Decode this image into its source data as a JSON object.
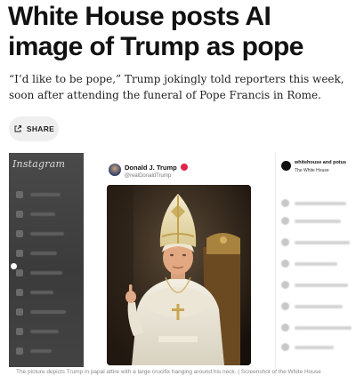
{
  "article": {
    "headline": "White House posts AI image of Trump as pope",
    "dek": "“I’d like to be pope,” Trump jokingly told reporters this week, soon after attending the funeral of Pope Francis in Rome.",
    "share_label": "SHARE"
  },
  "figure": {
    "instagram_logo": "Instagram",
    "post": {
      "display_name": "Donald J. Trump",
      "handle": "@realDonaldTrump"
    },
    "comments_panel": {
      "user": "whitehouse and potus",
      "subtitle": "The White House"
    },
    "caption": "The picture depicts Trump in papal attire with a large crucifix hanging around his neck. | Screenshot of the White House"
  },
  "icons": {
    "share": "share-icon",
    "verified": "verified-badge-icon"
  },
  "colors": {
    "background": "#ffffff",
    "headline": "#111111",
    "share_pill": "#efefef",
    "instagram_sidebar": "#404040",
    "verified_badge": "#e0244a"
  }
}
